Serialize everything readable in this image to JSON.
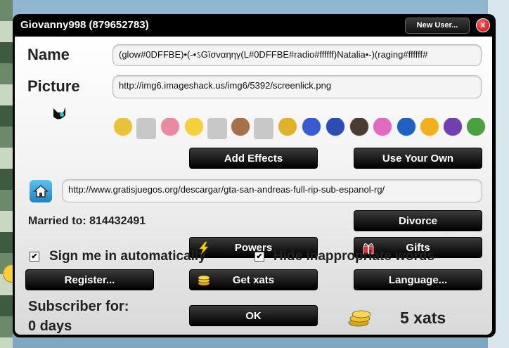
{
  "window": {
    "title": "Giovanny998 (879652783)",
    "new_user_label": "New User...",
    "close_label": "x"
  },
  "profile": {
    "name_label": "Name",
    "name_value": "(glow#0DFFBE)•(-•ઽGïσναηηγ(L#0DFFBE#radio#ffffff)Natalia•-)(raging#ffffff#",
    "picture_label": "Picture",
    "picture_value": "http://img6.imageshack.us/img6/5392/screenlick.png",
    "homepage_value": "http://www.gratisjuegos.org/descargar/gta-san-andreas-full-rip-sub-espanol-rg/",
    "married_label": "Married to: 814432491"
  },
  "avatars": [
    {
      "name": "avatar-hat-guy",
      "color": "#e8c23a"
    },
    {
      "name": "avatar-blank",
      "color": "#c8c8c8"
    },
    {
      "name": "avatar-pink-creature",
      "color": "#e98aa0"
    },
    {
      "name": "avatar-bart",
      "color": "#f4d03f"
    },
    {
      "name": "avatar-blank",
      "color": "#c8c8c8"
    },
    {
      "name": "avatar-old-man",
      "color": "#a47148"
    },
    {
      "name": "avatar-blank",
      "color": "#c8c8c8"
    },
    {
      "name": "avatar-top-hat",
      "color": "#e0b22c"
    },
    {
      "name": "avatar-police",
      "color": "#3a5bd0"
    },
    {
      "name": "avatar-ninja",
      "color": "#2a4fb0"
    },
    {
      "name": "avatar-dark-hair",
      "color": "#4a3a30"
    },
    {
      "name": "avatar-pink-bubble",
      "color": "#e06ac0"
    },
    {
      "name": "avatar-batman",
      "color": "#2060c0"
    },
    {
      "name": "avatar-pacman",
      "color": "#f0b020"
    },
    {
      "name": "avatar-wizard",
      "color": "#7040b0"
    },
    {
      "name": "avatar-green-runner",
      "color": "#4aa040"
    }
  ],
  "buttons": {
    "add_effects": "Add Effects",
    "use_your_own": "Use Your Own",
    "divorce": "Divorce",
    "powers": "Powers",
    "gifts": "Gifts",
    "register": "Register...",
    "get_xats": "Get xats",
    "language": "Language...",
    "ok": "OK"
  },
  "options": {
    "sign_in_auto": "Sign me in automatically",
    "sign_in_auto_checked": "✔",
    "hide_words": "Hide inappropriate words",
    "hide_words_checked": "✔"
  },
  "subscriber": {
    "line1": "Subscriber for:",
    "line2": "0 days"
  },
  "xats": {
    "balance": "5 xats"
  },
  "colors": {
    "dialog_bg": "#000000",
    "panel_top": "#ffffff",
    "panel_bottom": "#d9d9d9",
    "close_red": "#c40000",
    "home_blue": "#2f9bd6"
  }
}
